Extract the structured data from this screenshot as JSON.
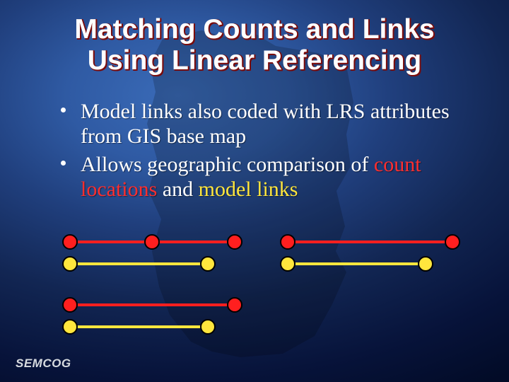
{
  "title": {
    "line1": "Matching Counts and Links",
    "line2": "Using Linear Referencing"
  },
  "bullets": [
    {
      "pre": "Model links also coded with LRS attributes from GIS base map"
    },
    {
      "pre": "Allows geographic comparison of ",
      "hl1": "count locations",
      "mid": " and ",
      "hl2": "model links"
    }
  ],
  "logo": "SEMCOG"
}
